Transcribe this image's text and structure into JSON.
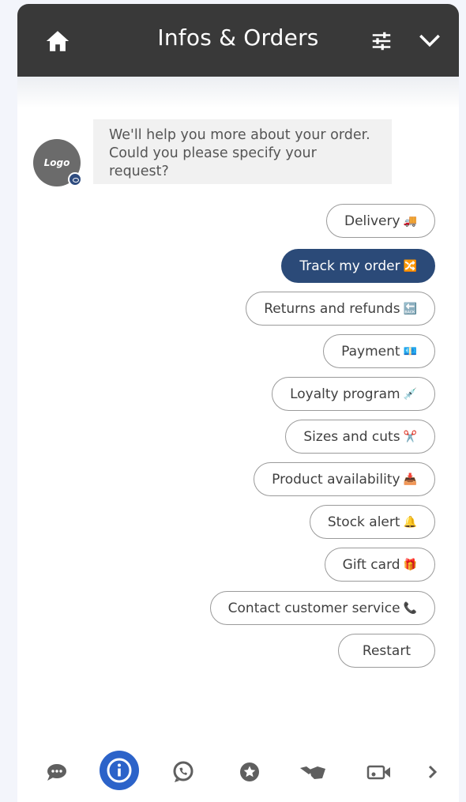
{
  "header": {
    "title": "Infos & Orders",
    "home_icon": "home-icon",
    "settings_icon": "sliders-icon",
    "collapse_icon": "chevron-down-icon"
  },
  "bot": {
    "avatar_label": "Logo",
    "message": "We'll help you more about your order. Could you please specify your request?"
  },
  "options": [
    {
      "label": "Delivery",
      "emoji": "🚚",
      "selected": false
    },
    {
      "label": "Track my order",
      "emoji": "🔀",
      "selected": true
    },
    {
      "label": "Returns and refunds",
      "emoji": "🔙",
      "selected": false
    },
    {
      "label": "Payment",
      "emoji": "💶",
      "selected": false
    },
    {
      "label": "Loyalty program",
      "emoji": "💉",
      "selected": false
    },
    {
      "label": "Sizes and cuts",
      "emoji": "✂️",
      "selected": false
    },
    {
      "label": "Product availability",
      "emoji": "📥",
      "selected": false
    },
    {
      "label": "Stock alert",
      "emoji": "🔔",
      "selected": false
    },
    {
      "label": "Gift card",
      "emoji": "🎁",
      "selected": false
    },
    {
      "label": "Contact customer service",
      "emoji": "📞",
      "selected": false
    },
    {
      "label": "Restart",
      "emoji": "",
      "selected": false
    }
  ],
  "tabbar": {
    "items": [
      "chat-icon",
      "info-icon",
      "whatsapp-icon",
      "star-icon",
      "handshake-icon",
      "video-call-icon",
      "chevron-right-icon"
    ],
    "active": "info-icon",
    "accent": "#2c63c9"
  },
  "colors": {
    "header_bg": "#393939",
    "selected_bg": "#2b4a78",
    "icon_gray": "#5f5f5f"
  }
}
